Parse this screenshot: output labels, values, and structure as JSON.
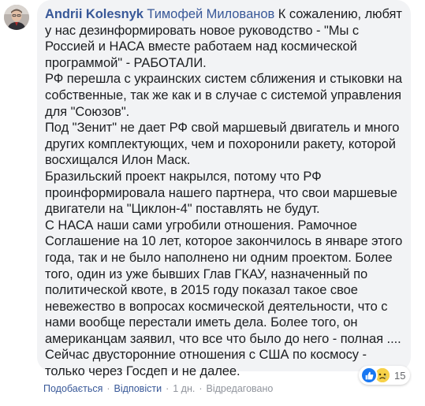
{
  "comment": {
    "author": "Andrii Kolesnyk",
    "mention": "Тимофей Миловaнов",
    "paragraphs": [
      "К сожалению, любят у нас дезинформировать новое руководство - \"Мы с Россией и НАСА вместе работаем над космической программой\" - РАБОТАЛИ.",
      "РФ перешла с украинских систем сближения и стыковки на собственные, так же как и в случае с системой управления для \"Союзов\".",
      "Под \"Зенит\" не дает РФ свой маршевый двигатель и много других комплектующих, чем и похоронили ракету, которой восхищался Илон Маск.",
      "Бразильский проект накрылся, потому что РФ проинформировала нашего партнера, что свои маршевые двигатели на \"Циклон-4\" поставлять не будут.",
      "С НАСА наши сами угробили отношения. Рамочное Соглашение на 10 лет, которое закончилось в январе этого года, так и не было наполнено ни одним проектом. Более того, один из уже бывших Глав ГКАУ, назначенный по политической квоте, в 2015 году показал такое свое невежество в вопросах космической деятельности, что с нами вообще перестали иметь дела. Более того, он американцам заявил, что все что было до него - полная .... Сейчас двусторонние отношения с США по космосу - только через Госдеп и не далее."
    ],
    "reactions": {
      "icons": [
        "like-icon",
        "sad-icon"
      ],
      "count": "15",
      "like_color": "#1877f2",
      "sad_color": "#f7d148"
    },
    "actions": {
      "like": "Подобається",
      "reply": "Відповісти",
      "time": "1 дн.",
      "edited": "Відредаговано"
    }
  },
  "colors": {
    "link": "#385898",
    "bubble": "#f2f3f5",
    "meta": "#90949c",
    "text": "#1c1e21"
  }
}
